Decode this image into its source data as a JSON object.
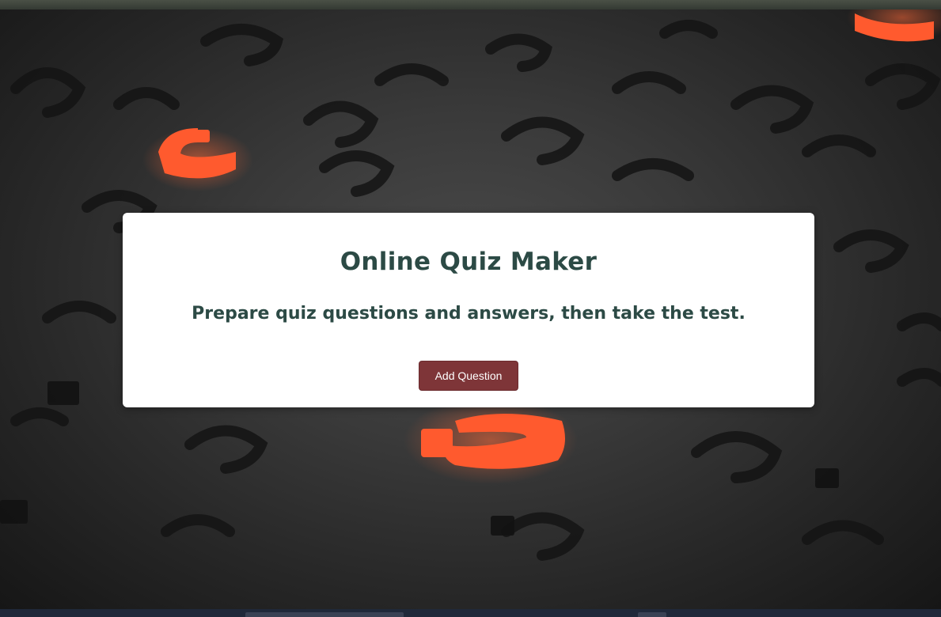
{
  "page": {
    "title": "Online Quiz Maker",
    "subtitle": "Prepare quiz questions and answers, then take the test."
  },
  "actions": {
    "add_question_label": "Add Question"
  },
  "background": {
    "image": "question-marks-background",
    "accent_color": "#ff5a2e"
  },
  "colors": {
    "heading": "#2c4a45",
    "button": "#7e3538",
    "card": "#ffffff"
  }
}
